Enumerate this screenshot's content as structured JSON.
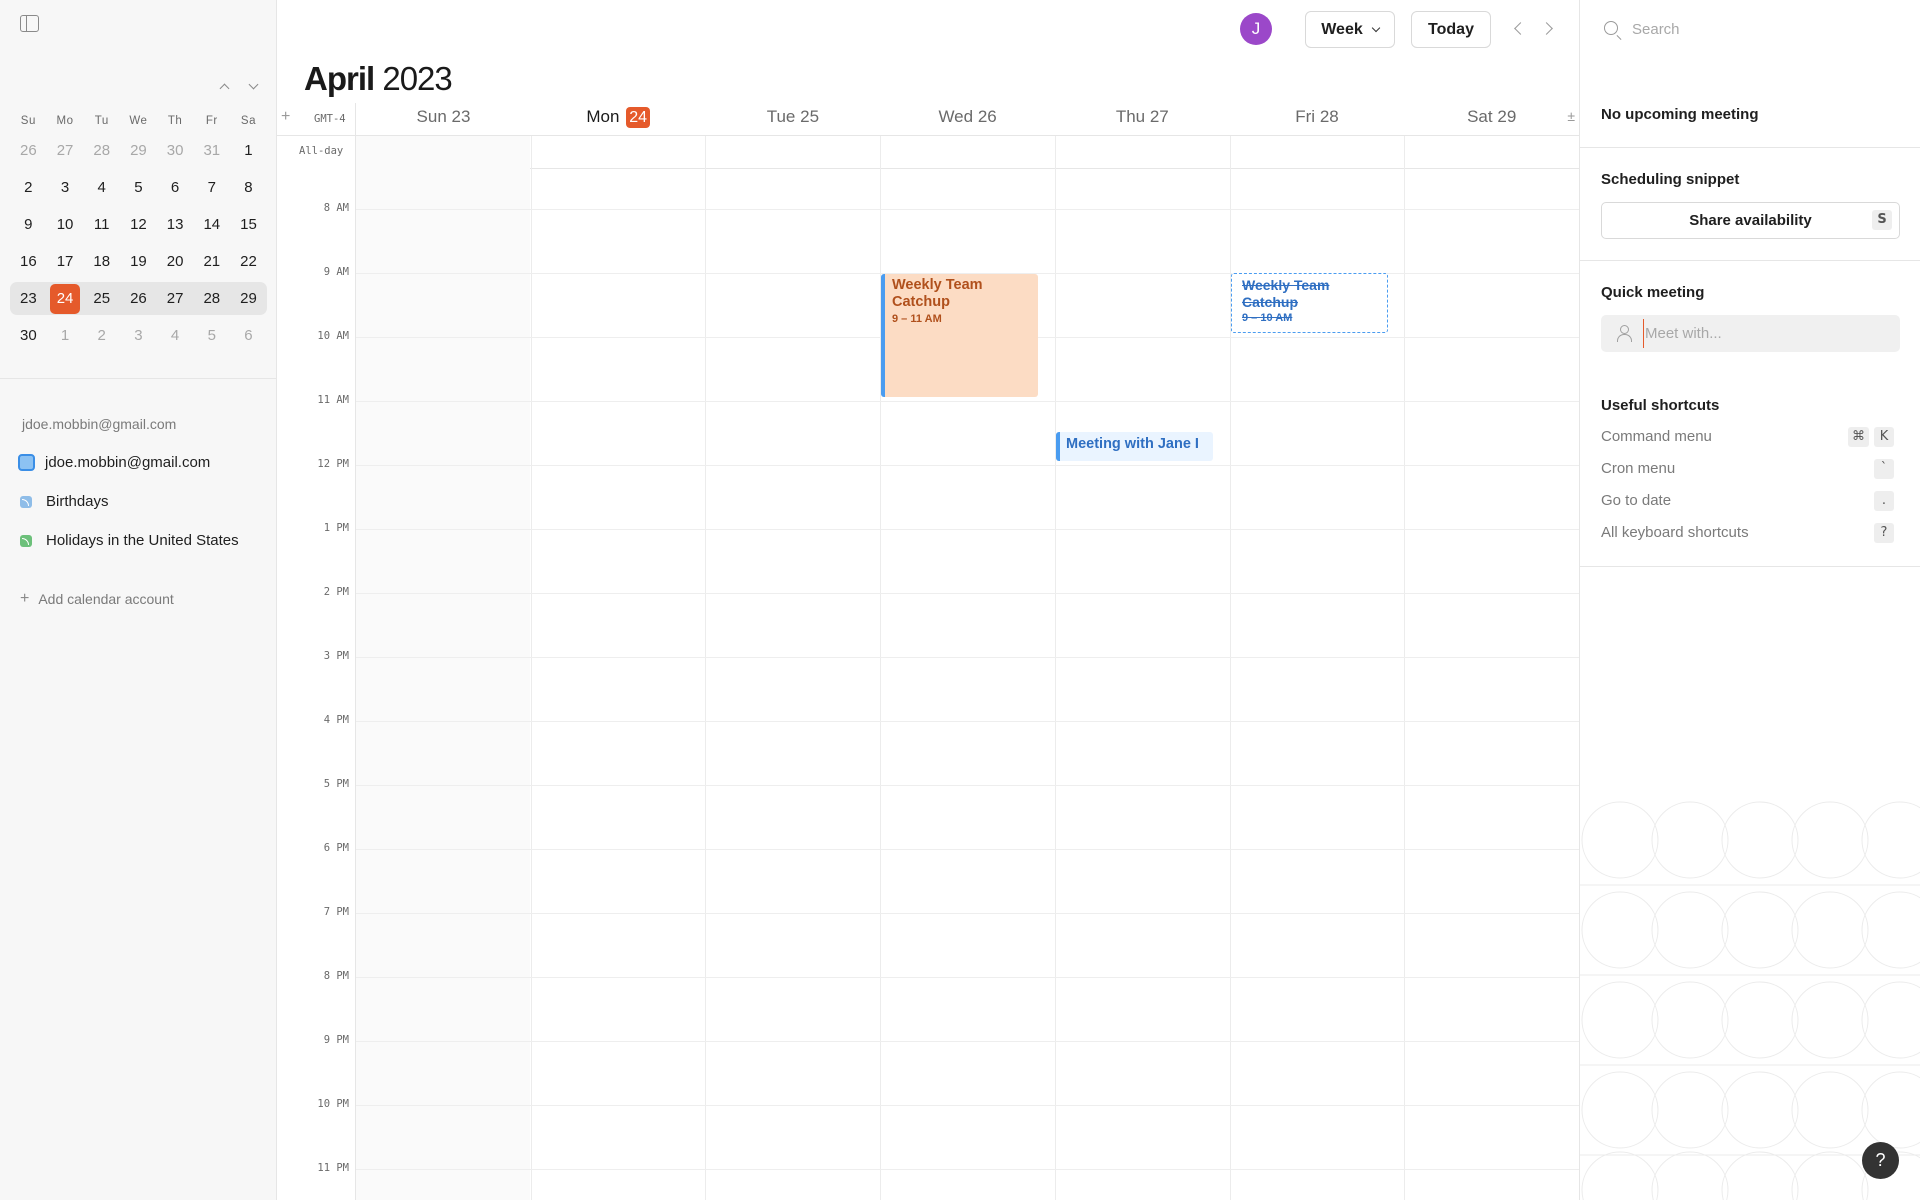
{
  "sidebar": {
    "mini_calendar": {
      "weekdays": [
        "Su",
        "Mo",
        "Tu",
        "We",
        "Th",
        "Fr",
        "Sa"
      ],
      "weeks": [
        [
          {
            "d": "26",
            "m": true
          },
          {
            "d": "27",
            "m": true
          },
          {
            "d": "28",
            "m": true
          },
          {
            "d": "29",
            "m": true
          },
          {
            "d": "30",
            "m": true
          },
          {
            "d": "31",
            "m": true
          },
          {
            "d": "1"
          }
        ],
        [
          {
            "d": "2"
          },
          {
            "d": "3"
          },
          {
            "d": "4"
          },
          {
            "d": "5"
          },
          {
            "d": "6"
          },
          {
            "d": "7"
          },
          {
            "d": "8"
          }
        ],
        [
          {
            "d": "9"
          },
          {
            "d": "10"
          },
          {
            "d": "11"
          },
          {
            "d": "12"
          },
          {
            "d": "13"
          },
          {
            "d": "14"
          },
          {
            "d": "15"
          }
        ],
        [
          {
            "d": "16"
          },
          {
            "d": "17"
          },
          {
            "d": "18"
          },
          {
            "d": "19"
          },
          {
            "d": "20"
          },
          {
            "d": "21"
          },
          {
            "d": "22"
          }
        ],
        [
          {
            "d": "23"
          },
          {
            "d": "24",
            "today": true
          },
          {
            "d": "25"
          },
          {
            "d": "26"
          },
          {
            "d": "27"
          },
          {
            "d": "28"
          },
          {
            "d": "29"
          }
        ],
        [
          {
            "d": "30"
          },
          {
            "d": "1",
            "m": true
          },
          {
            "d": "2",
            "m": true
          },
          {
            "d": "3",
            "m": true
          },
          {
            "d": "4",
            "m": true
          },
          {
            "d": "5",
            "m": true
          },
          {
            "d": "6",
            "m": true
          }
        ]
      ],
      "current_week_index": 4
    },
    "account_email": "jdoe.mobbin@gmail.com",
    "calendars": [
      {
        "label": "jdoe.mobbin@gmail.com",
        "color": "#3a8ee6"
      },
      {
        "label": "Birthdays",
        "color": "#8fbde8"
      },
      {
        "label": "Holidays in the United States",
        "color": "#6cc07a"
      }
    ],
    "add_account_label": "Add calendar account"
  },
  "header": {
    "month": "April",
    "year": "2023",
    "avatar_initial": "J",
    "view_label": "Week",
    "today_label": "Today"
  },
  "week": {
    "timezone": "GMT-4",
    "all_day_label": "All-day",
    "days": [
      {
        "name": "Sun",
        "num": "23"
      },
      {
        "name": "Mon",
        "num": "24",
        "today": true
      },
      {
        "name": "Tue",
        "num": "25"
      },
      {
        "name": "Wed",
        "num": "26"
      },
      {
        "name": "Thu",
        "num": "27"
      },
      {
        "name": "Fri",
        "num": "28"
      },
      {
        "name": "Sat",
        "num": "29"
      }
    ],
    "hours": [
      "8 AM",
      "9 AM",
      "10 AM",
      "11 AM",
      "12 PM",
      "1 PM",
      "2 PM",
      "3 PM",
      "4 PM",
      "5 PM",
      "6 PM",
      "7 PM",
      "8 PM",
      "9 PM",
      "10 PM",
      "11 PM"
    ],
    "events": [
      {
        "title": "Weekly Team Catchup",
        "time": "9 – 11 AM"
      },
      {
        "title": "Weekly Team Catchup",
        "time": "9 – 10 AM",
        "declined": true
      },
      {
        "title": "Meeting with Jane I"
      }
    ]
  },
  "right_panel": {
    "search_placeholder": "Search",
    "upcoming": "No upcoming meeting",
    "scheduling_heading": "Scheduling snippet",
    "share_label": "Share availability",
    "share_key": "S",
    "quick_heading": "Quick meeting",
    "meet_placeholder": "Meet with...",
    "shortcuts_heading": "Useful shortcuts",
    "shortcuts": [
      {
        "label": "Command menu",
        "keys": [
          "⌘",
          "K"
        ]
      },
      {
        "label": "Cron menu",
        "keys": [
          "`"
        ]
      },
      {
        "label": "Go to date",
        "keys": [
          "."
        ]
      },
      {
        "label": "All keyboard shortcuts",
        "keys": [
          "?"
        ]
      }
    ],
    "help_label": "?"
  }
}
